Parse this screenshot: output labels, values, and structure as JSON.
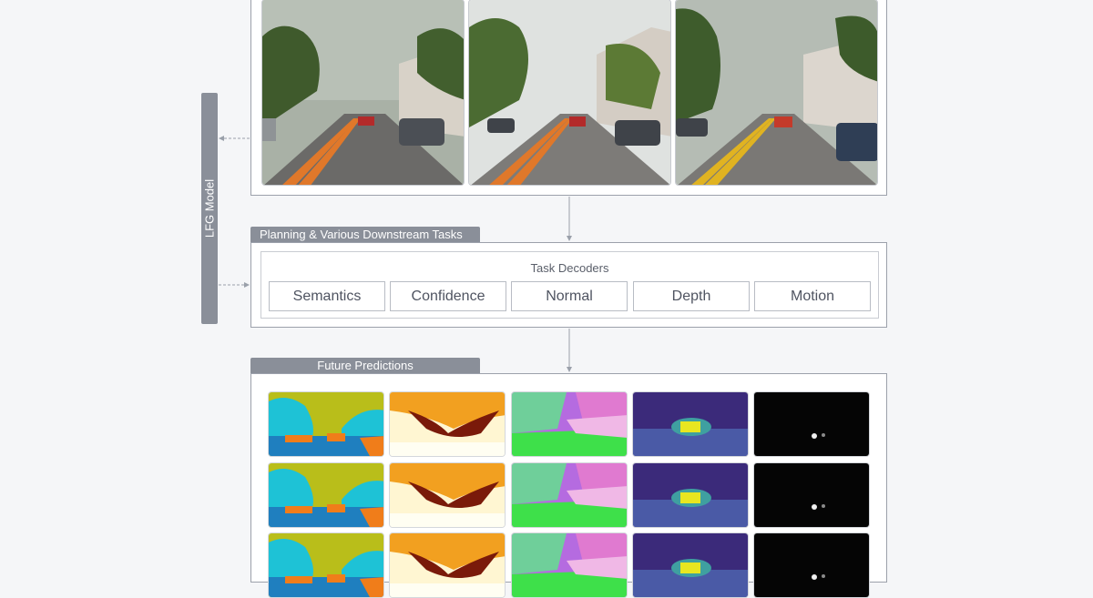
{
  "lfg_model": {
    "label": "LFG Model"
  },
  "sections": {
    "planning": {
      "title": "Planning & Various Downstream Tasks"
    },
    "predictions": {
      "title": "Future Predictions"
    }
  },
  "task_decoders": {
    "title": "Task Decoders",
    "items": [
      "Semantics",
      "Confidence",
      "Normal",
      "Depth",
      "Motion"
    ]
  },
  "input_frames": [
    {
      "name": "street-frame-1"
    },
    {
      "name": "street-frame-2"
    },
    {
      "name": "street-frame-3"
    }
  ],
  "prediction_rows": [
    [
      "semantics",
      "confidence",
      "normal",
      "depth",
      "motion"
    ],
    [
      "semantics",
      "confidence",
      "normal",
      "depth",
      "motion"
    ],
    [
      "semantics",
      "confidence",
      "normal",
      "depth",
      "motion"
    ]
  ],
  "colors": {
    "frame_border": "#9ca1ab",
    "tab_fill": "#8a8f99",
    "arrow": "#9aa0aa",
    "semantic_sky": "#b9be1a",
    "semantic_vegetation": "#1ec2d6",
    "semantic_road": "#1f7fbf",
    "semantic_car": "#f07d1a",
    "depth_far": "#3b2a7a",
    "depth_near": "#e8e620"
  }
}
